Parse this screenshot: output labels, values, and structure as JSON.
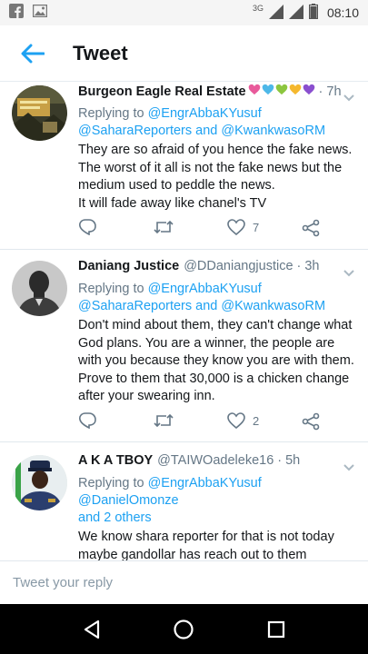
{
  "status_bar": {
    "time": "08:10",
    "network": "3G"
  },
  "header": {
    "title": "Tweet"
  },
  "tweets": [
    {
      "name": "Burgeon Eagle Real Estate",
      "handle": "",
      "time": "· 7h",
      "replying_prefix": "Replying to ",
      "replying_to_1": "@EngrAbbaKYusuf",
      "replying_to_2": "@SaharaReporters",
      "replying_and": " and ",
      "replying_to_3": "@KwankwasoRM",
      "text_lines": [
        "They are so afraid of you hence the fake news. The worst of it all is not the fake news but the medium used to peddle the news.",
        "It will fade away like chanel's TV"
      ],
      "reply_count": "",
      "retweet_count": "",
      "like_count": "7",
      "heart_colors": [
        "#e85a9b",
        "#4db8e8",
        "#8cc63f",
        "#f5b82e",
        "#8a4fcf"
      ]
    },
    {
      "name": "Daniang Justice",
      "handle": "@DDaniangjustice",
      "time": "· 3h",
      "replying_prefix": "Replying to ",
      "replying_to_1": "@EngrAbbaKYusuf",
      "replying_to_2": "@SaharaReporters",
      "replying_and": " and ",
      "replying_to_3": "@KwankwasoRM",
      "text_lines": [
        "Don't mind about them, they can't change what God plans. You are a winner, the people are with you because they know you are with them. Prove to them that 30,000 is a chicken change after your swearing inn."
      ],
      "reply_count": "",
      "retweet_count": "",
      "like_count": "2"
    },
    {
      "name": "A K A TBOY",
      "handle": "@TAIWOadeleke16",
      "time": "· 5h",
      "replying_prefix": "Replying to ",
      "replying_to_1": "@EngrAbbaKYusuf",
      "replying_to_2": "@DanielOmonze",
      "replying_to_3": "and 2 others",
      "text_lines": [
        "We know shara reporter for that is not today maybe gandollar has reach out to them"
      ]
    }
  ],
  "reply_bar": {
    "placeholder": "Tweet your reply"
  },
  "colors": {
    "accent": "#1da1f2",
    "secondary_text": "#657786"
  }
}
